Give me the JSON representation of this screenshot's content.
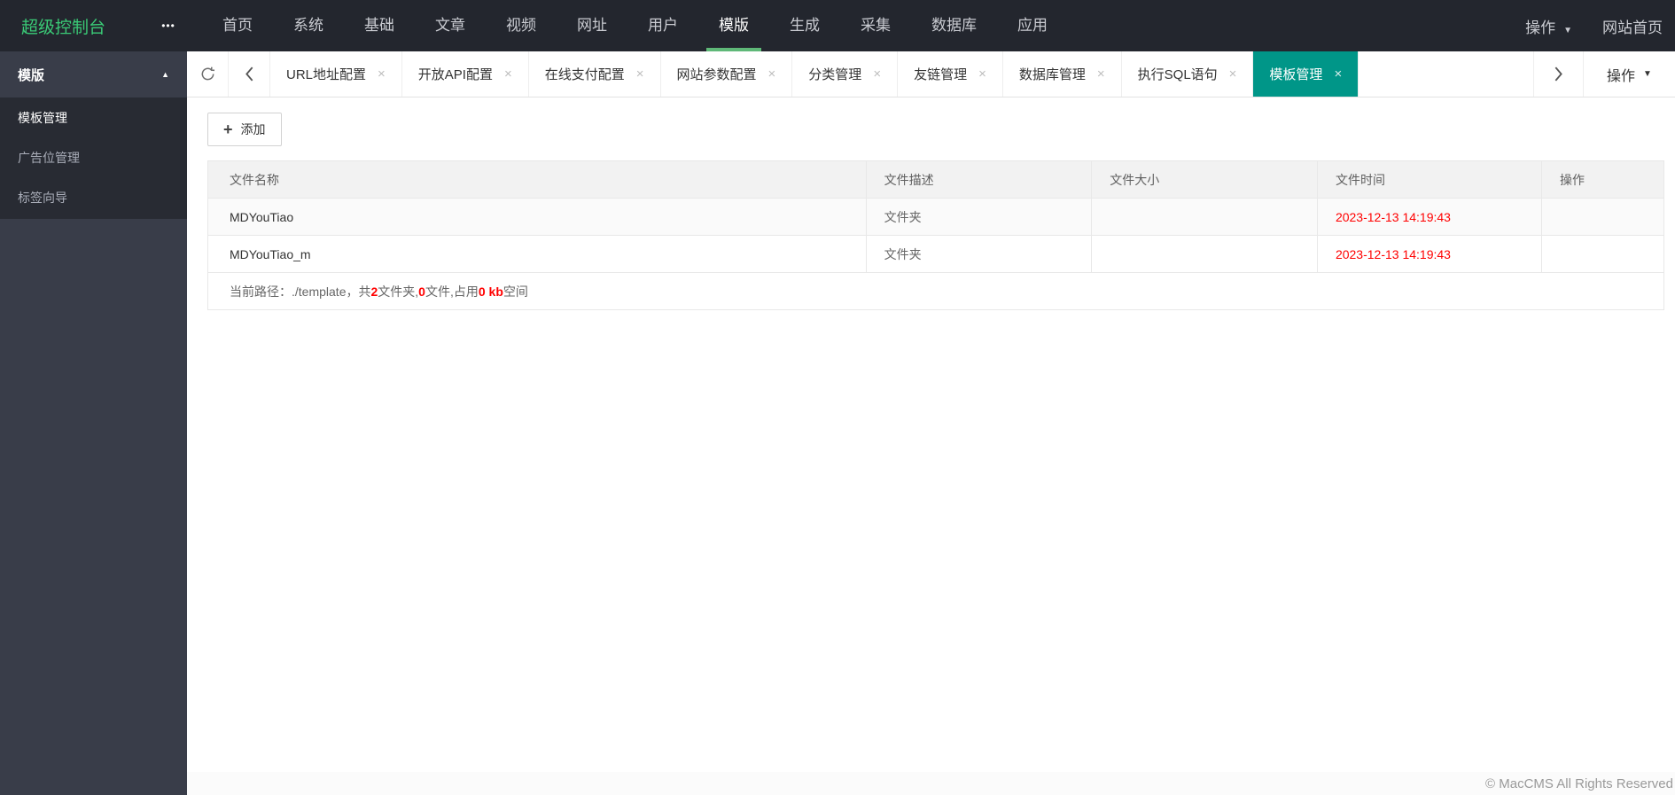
{
  "brand": "超级控制台",
  "icons": {
    "ellipsis": "•••",
    "caret_down": "▼",
    "arrow_up": "▲",
    "close": "×",
    "plus": "+"
  },
  "colors": {
    "navbar_bg": "#23262E",
    "sidebar_bg": "#393D49",
    "submenu_bg": "#282B33",
    "brand_green": "#3ACA76",
    "underline_green": "#5FB878",
    "active_tab": "#009688",
    "header_bg": "#F2F2F2",
    "table_border": "#E8E8E8",
    "red": "#FF0000"
  },
  "topnav": {
    "items": [
      {
        "label": "首页",
        "active": false
      },
      {
        "label": "系统",
        "active": false
      },
      {
        "label": "基础",
        "active": false
      },
      {
        "label": "文章",
        "active": false
      },
      {
        "label": "视频",
        "active": false
      },
      {
        "label": "网址",
        "active": false
      },
      {
        "label": "用户",
        "active": false
      },
      {
        "label": "模版",
        "active": true
      },
      {
        "label": "生成",
        "active": false
      },
      {
        "label": "采集",
        "active": false
      },
      {
        "label": "数据库",
        "active": false
      },
      {
        "label": "应用",
        "active": false
      }
    ],
    "action_label": "操作",
    "site_home_label": "网站首页"
  },
  "sidebar": {
    "group_title": "模版",
    "items": [
      {
        "label": "模板管理",
        "active": true
      },
      {
        "label": "广告位管理",
        "active": false
      },
      {
        "label": "标签向导",
        "active": false
      }
    ]
  },
  "tabbar": {
    "tabs": [
      {
        "label": "URL地址配置",
        "active": false
      },
      {
        "label": "开放API配置",
        "active": false
      },
      {
        "label": "在线支付配置",
        "active": false
      },
      {
        "label": "网站参数配置",
        "active": false
      },
      {
        "label": "分类管理",
        "active": false
      },
      {
        "label": "友链管理",
        "active": false
      },
      {
        "label": "数据库管理",
        "active": false
      },
      {
        "label": "执行SQL语句",
        "active": false
      },
      {
        "label": "模板管理",
        "active": true
      }
    ],
    "action_label": "操作"
  },
  "toolbar": {
    "add_label": "添加"
  },
  "table": {
    "headers": [
      "文件名称",
      "文件描述",
      "文件大小",
      "文件时间",
      "操作"
    ],
    "rows": [
      {
        "name": "MDYouTiao",
        "desc": "文件夹",
        "size": "",
        "time": "2023-12-13 14:19:43",
        "action": ""
      },
      {
        "name": "MDYouTiao_m",
        "desc": "文件夹",
        "size": "",
        "time": "2023-12-13 14:19:43",
        "action": ""
      }
    ],
    "summary": {
      "prefix": "当前路径：./template，共",
      "folders": "2",
      "mid1": "文件夹,",
      "files": "0",
      "mid2": "文件,占用",
      "size": "0 kb",
      "suffix": "空间"
    }
  },
  "footer": {
    "copyright": "© MacCMS All Rights Reserved"
  }
}
